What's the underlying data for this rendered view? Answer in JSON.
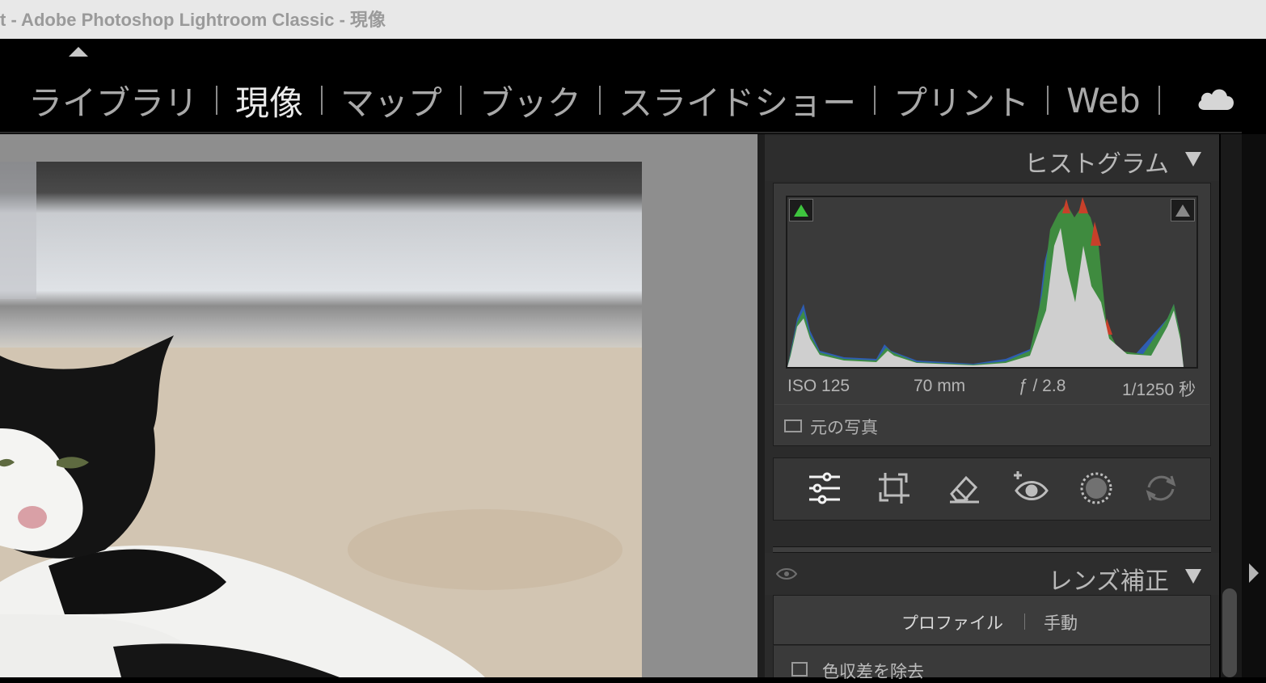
{
  "window": {
    "title": "t - Adobe Photoshop Lightroom Classic - 現像"
  },
  "modules": [
    {
      "label": "ライブラリ",
      "active": false
    },
    {
      "label": "現像",
      "active": true
    },
    {
      "label": "マップ",
      "active": false
    },
    {
      "label": "ブック",
      "active": false
    },
    {
      "label": "スライドショー",
      "active": false
    },
    {
      "label": "プリント",
      "active": false
    },
    {
      "label": "Web",
      "active": false
    }
  ],
  "icons": {
    "cloud": "cloud-icon",
    "eye": "eye-icon"
  },
  "histogram": {
    "title": "ヒストグラム",
    "exif": {
      "iso": "ISO 125",
      "focal": "70 mm",
      "aperture": "ƒ / 2.8",
      "shutter": "1/1250 秒"
    },
    "original_photo_label": "元の写真",
    "shadow_clipping_on": true,
    "highlight_clipping_on": false
  },
  "tools": [
    {
      "name": "edit-sliders-icon",
      "active": true
    },
    {
      "name": "crop-icon",
      "active": false
    },
    {
      "name": "eraser-icon",
      "active": false
    },
    {
      "name": "red-eye-icon",
      "active": false
    },
    {
      "name": "masking-icon",
      "active": false
    },
    {
      "name": "redo-icon",
      "active": false
    }
  ],
  "lens_correction": {
    "title": "レンズ補正",
    "tabs": [
      "プロファイル",
      "手動"
    ],
    "remove_ca_label": "色収差を除去"
  },
  "colors": {
    "shadow_clip": "#3ec43e",
    "panel_bg": "#2b2b2b",
    "canvas_bg": "#8e8e8e"
  }
}
